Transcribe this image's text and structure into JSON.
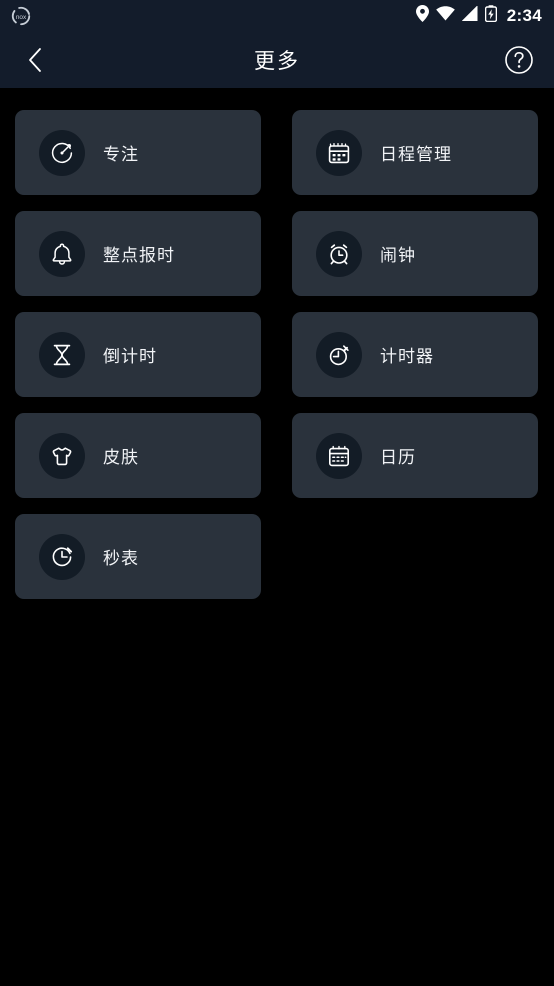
{
  "status_bar": {
    "notification_icon": "nox-logo-icon",
    "icons": [
      "location-pin-icon",
      "wifi-icon",
      "cellular-signal-icon",
      "battery-charging-icon"
    ],
    "time": "2:34"
  },
  "app_bar": {
    "back_icon": "back-chevron-icon",
    "title": "更多",
    "help_icon": "help-circle-icon"
  },
  "colors": {
    "page_background": "#000000",
    "header_background": "#131c2b",
    "card_background": "#2a323c",
    "icon_circle_background": "#131c26",
    "text_primary": "#f2f4f7",
    "icon_stroke": "#ffffff"
  },
  "grid": {
    "items": [
      {
        "label": "专注",
        "icon": "focus-gauge-icon"
      },
      {
        "label": "日程管理",
        "icon": "schedule-calendar-icon"
      },
      {
        "label": "整点报时",
        "icon": "bell-icon"
      },
      {
        "label": "闹钟",
        "icon": "alarm-clock-icon"
      },
      {
        "label": "倒计时",
        "icon": "hourglass-icon"
      },
      {
        "label": "计时器",
        "icon": "stopwatch-icon"
      },
      {
        "label": "皮肤",
        "icon": "tshirt-icon"
      },
      {
        "label": "日历",
        "icon": "calendar-icon"
      },
      {
        "label": "秒表",
        "icon": "stopwatch-dial-icon"
      }
    ]
  }
}
